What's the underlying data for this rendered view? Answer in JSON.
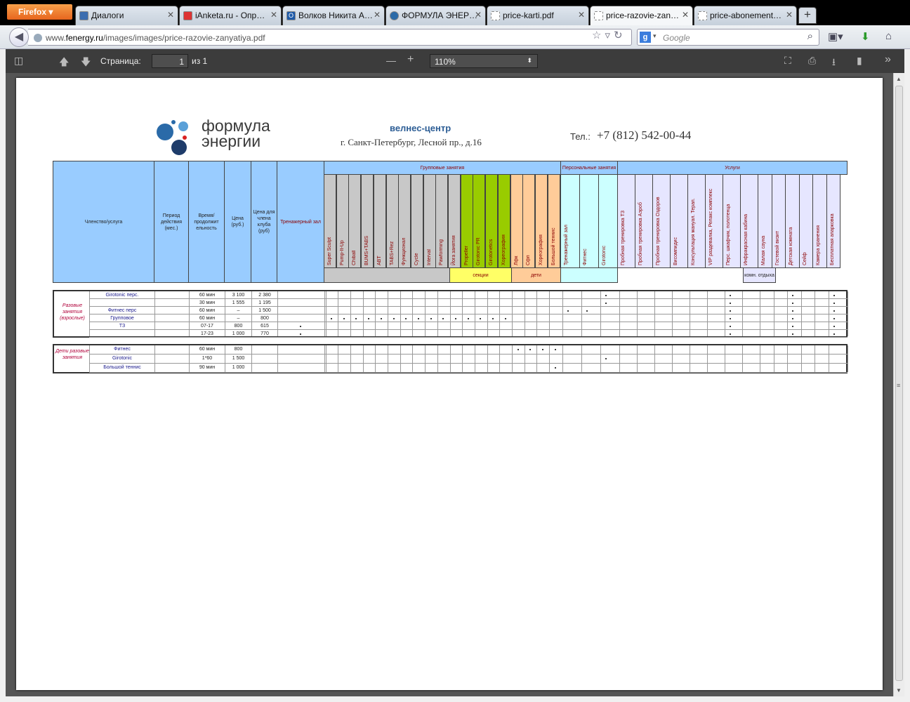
{
  "browser": {
    "menu_button": "Firefox",
    "tabs": [
      {
        "label": "Диалоги",
        "active": false
      },
      {
        "label": "iAnketa.ru - Опр…",
        "active": false
      },
      {
        "label": "Волков Никита А…",
        "active": false
      },
      {
        "label": "ФОРМУЛА ЭНЕР…",
        "active": false
      },
      {
        "label": "price-karti.pdf",
        "active": false
      },
      {
        "label": "price-razovie-zan…",
        "active": true
      },
      {
        "label": "price-abonement…",
        "active": false
      }
    ],
    "url_prefix": "www.",
    "url_domain": "fenergy.ru",
    "url_path": "/images/images/price-razovie-zanyatiya.pdf",
    "search_placeholder": "Google"
  },
  "pdf_toolbar": {
    "page_label": "Страница:",
    "page_value": "1",
    "page_of": "из 1",
    "zoom": "110%"
  },
  "document": {
    "brand_line1": "формула",
    "brand_line2": "энергии",
    "tagline": "велнес-центр",
    "address": "г. Санкт-Петербург, Лесной пр., д.16",
    "phone_label": "Тел.:",
    "phone": "+7 (812) 542-00-44",
    "header": {
      "membership": "Членство/услуга",
      "period": "Период действия (мес.)",
      "duration": "Время/ продолжит ельность",
      "price": "Цена (руб.)",
      "member_price": "Цена для члена клуба (руб)",
      "gym": "Тренажерный зал",
      "group_title": "Групповые занятия",
      "personal_title": "Персональные занятия",
      "services_title": "Услуги",
      "sections_label": "секции",
      "kids_label": "дети",
      "rooms_label": "комн. отдыха",
      "group_columns": [
        "Super Sculpt",
        "Pump-It-Up",
        "Chiball",
        "BUMS+TABS",
        "ABT",
        "TABS+Rez",
        "Функционал",
        "Cycle",
        "Interval",
        "Pawforming",
        "Йога занятия",
        "Propeller",
        "Girotonic PR",
        "Girotonetics",
        "Хореография",
        "Лфк",
        "Сфп",
        "Хореография",
        "Большой теннис"
      ],
      "personal_columns": [
        "Тренажерный зал",
        "Фитнес",
        "Girotonic"
      ],
      "service_columns": [
        "Пробная тренировка ТЗ",
        "Пробная тренировка Аэроб",
        "Пробная тренировка Оздоров",
        "Висомпидис",
        "Консультация мануал. Терап.",
        "VIP раздевалка, Релакс комплекс",
        "Перс. шкафчик, полотенца",
        "Инфракрасная кабина",
        "Малая сауна",
        "Гостевой визит",
        "Детская комната",
        "Сейф",
        "Камера хранения",
        "Бесплатная апарковка"
      ]
    },
    "adult_group_label": "Разовые занятия (взрослые)",
    "kids_group_label": "Дети разовые занятия",
    "adult_rows": [
      {
        "service": "Girotonic перс.",
        "duration": "60 мин",
        "price": "3 100",
        "member": "2 380"
      },
      {
        "service": "",
        "duration": "30 мин",
        "price": "1 555",
        "member": "1 195"
      },
      {
        "service": "Фитнес перс",
        "duration": "60 мин",
        "price": "–",
        "member": "1 500"
      },
      {
        "service": "Групповое",
        "duration": "60 мин",
        "price": "–",
        "member": "800"
      },
      {
        "service": "ТЗ",
        "duration": "07-17",
        "price": "800",
        "member": "615"
      },
      {
        "service": "",
        "duration": "17-23",
        "price": "1 000",
        "member": "770"
      }
    ],
    "kids_rows": [
      {
        "service": "Фитнес",
        "duration": "60 мин",
        "price": "800",
        "member": ""
      },
      {
        "service": "Girotonic",
        "duration": "1*60",
        "price": "1 500",
        "member": ""
      },
      {
        "service": "Большой теннис",
        "duration": "90 мин",
        "price": "1 000",
        "member": ""
      }
    ]
  }
}
